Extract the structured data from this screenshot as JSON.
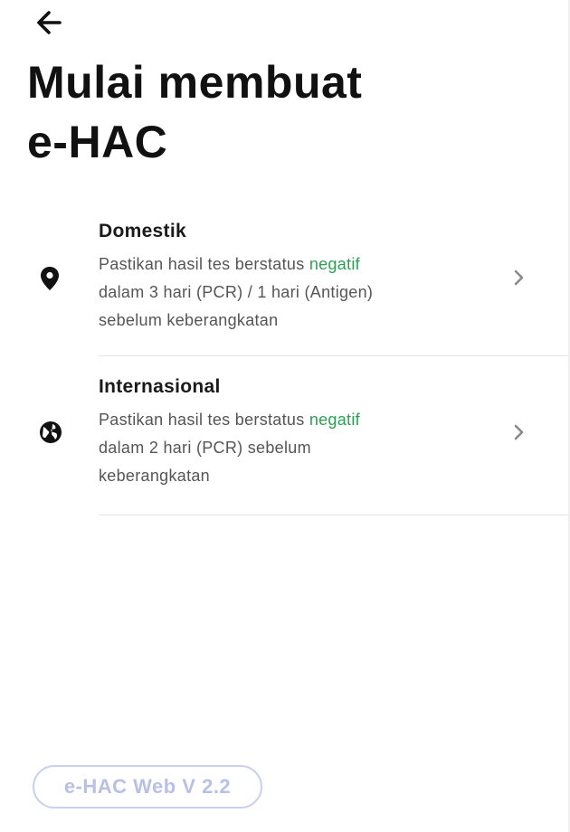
{
  "header": {
    "back_icon": "arrow-left-icon",
    "title_line1": "Mulai membuat",
    "title_line2": "e-HAC"
  },
  "options": [
    {
      "icon": "location-pin-icon",
      "title": "Domestik",
      "desc_prefix": "Pastikan hasil tes berstatus ",
      "desc_highlight": "negatif",
      "desc_line2": "dalam 3 hari (PCR) / 1 hari (Antigen)",
      "desc_line3": "sebelum keberangkatan",
      "chevron": "chevron-right-icon"
    },
    {
      "icon": "globe-icon",
      "title": "Internasional",
      "desc_prefix": "Pastikan hasil tes berstatus ",
      "desc_highlight": "negatif",
      "desc_line2": "dalam 2 hari (PCR) sebelum",
      "desc_line3": "keberangkatan",
      "chevron": "chevron-right-icon"
    }
  ],
  "footer": {
    "version_label": "e-HAC Web V 2.2"
  },
  "colors": {
    "highlight": "#2e9e55",
    "badge_border": "#c9d0f0",
    "badge_text": "#b8c0e6",
    "divider": "#e4e4e4"
  }
}
